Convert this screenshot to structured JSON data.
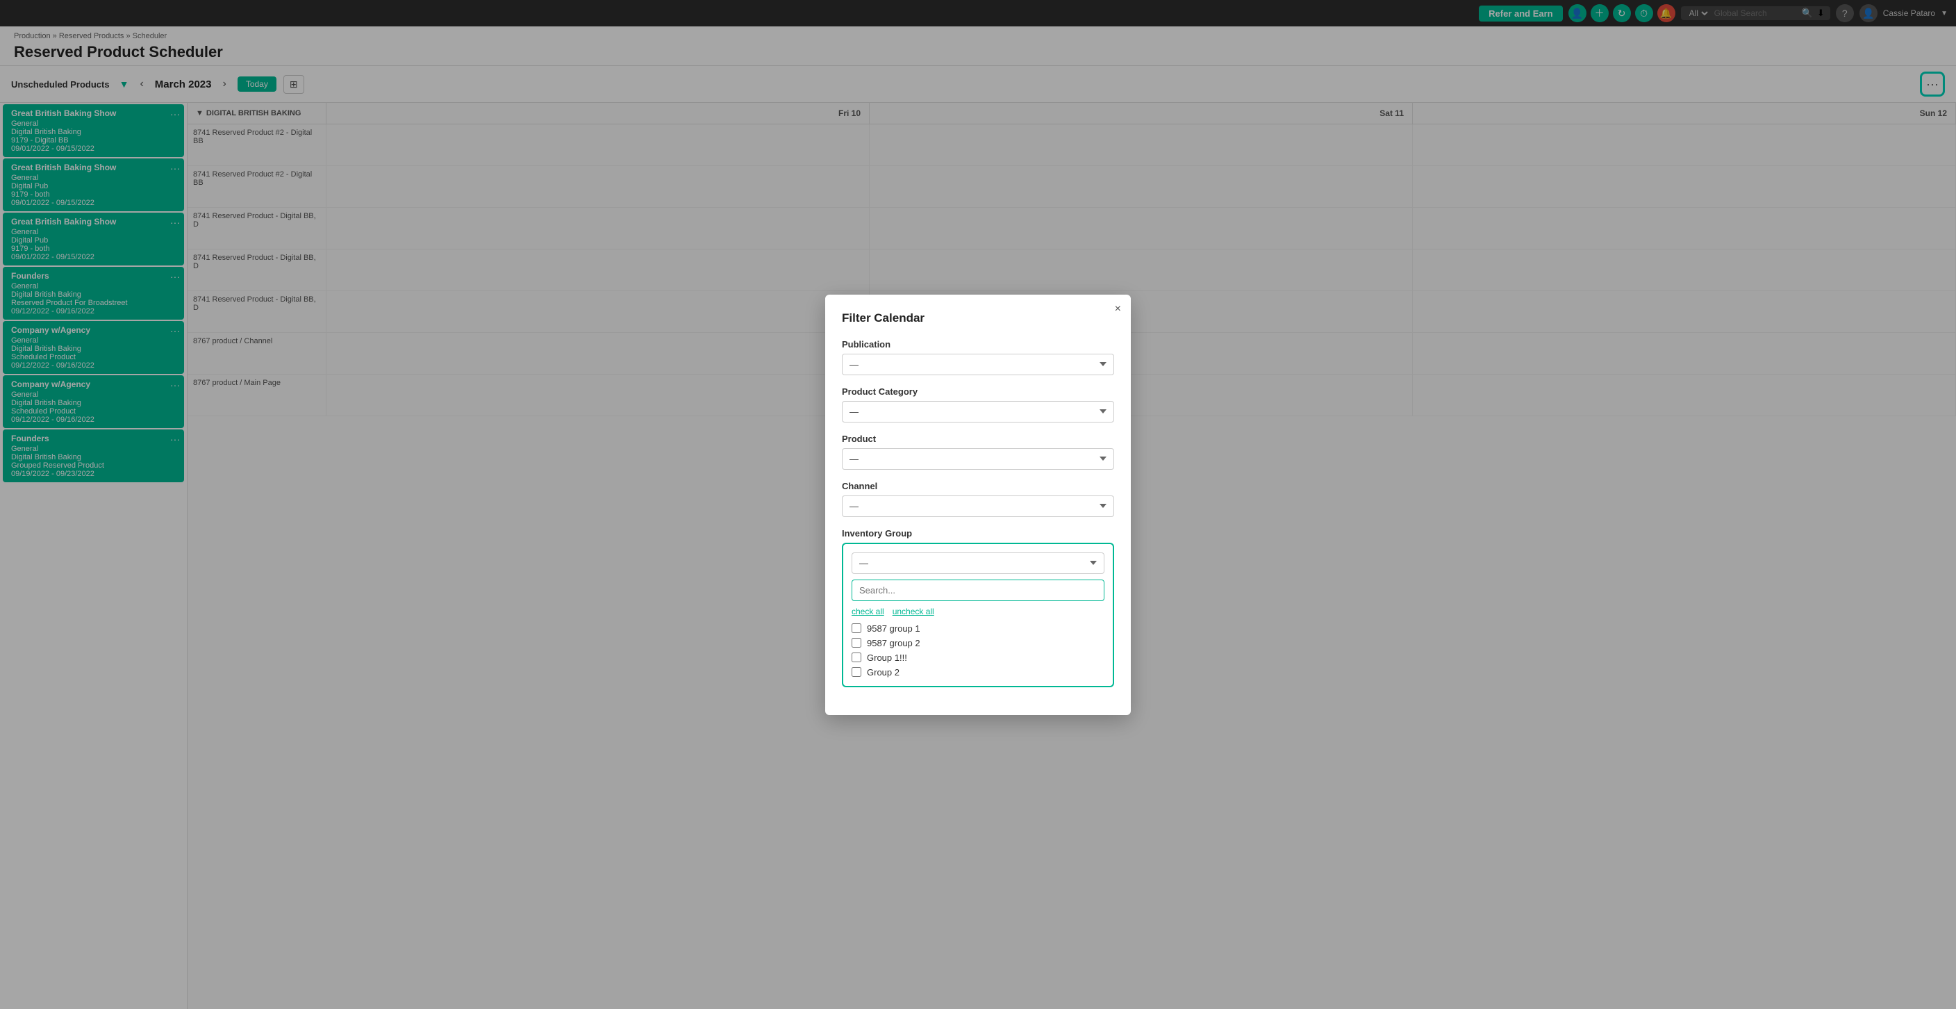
{
  "navbar": {
    "refer_label": "Refer and Earn",
    "search_placeholder": "Global Search",
    "search_scope": "All",
    "user": "Cassie Pataro"
  },
  "breadcrumb": {
    "parts": [
      "Production",
      "Reserved Products",
      "Scheduler"
    ]
  },
  "page": {
    "title": "Reserved Product Scheduler"
  },
  "toolbar": {
    "unscheduled_label": "Unscheduled Products",
    "prev_label": "‹",
    "next_label": "›",
    "month": "March 2023",
    "today_label": "Today",
    "more_label": "···"
  },
  "calendar": {
    "headers": [
      "",
      "Fri 10",
      "Sat 11",
      "Sun 12"
    ],
    "group_label": "DIGITAL BRITISH BAKING",
    "rows": [
      {
        "label": "8741 Reserved Product #2 - Digital BB",
        "fri": "",
        "sat": "",
        "sun": ""
      },
      {
        "label": "8741 Reserved Product #2 - Digital BB",
        "fri": "",
        "sat": "",
        "sun": ""
      },
      {
        "label": "8741 Reserved Product - Digital BB, D",
        "fri": "",
        "sat": "",
        "sun": ""
      },
      {
        "label": "8741 Reserved Product - Digital BB, D",
        "fri": "",
        "sat": "",
        "sun": ""
      },
      {
        "label": "8741 Reserved Product - Digital BB, D",
        "fri": "",
        "sat": "",
        "sun": ""
      },
      {
        "label": "8767 product / Channel",
        "fri": "",
        "sat": "",
        "sun": ""
      },
      {
        "label": "8767 product / Main Page",
        "fri": "",
        "sat": "",
        "sun": ""
      }
    ]
  },
  "left_panel": {
    "items": [
      {
        "title": "Great British Baking Show",
        "sub1": "General",
        "sub2": "Digital British Baking",
        "sub3": "9179 - Digital BB",
        "dates": "09/01/2022 - 09/15/2022"
      },
      {
        "title": "Great British Baking Show",
        "sub1": "General",
        "sub2": "Digital Pub",
        "sub3": "9179 - both",
        "dates": "09/01/2022 - 09/15/2022"
      },
      {
        "title": "Great British Baking Show",
        "sub1": "General",
        "sub2": "Digital Pub",
        "sub3": "9179 - both",
        "dates": "09/01/2022 - 09/15/2022"
      },
      {
        "title": "Founders",
        "sub1": "General",
        "sub2": "Digital British Baking",
        "sub3": "Reserved Product For Broadstreet",
        "dates": "09/12/2022 - 09/16/2022"
      },
      {
        "title": "Company w/Agency",
        "sub1": "General",
        "sub2": "Digital British Baking",
        "sub3": "Scheduled Product",
        "dates": "09/12/2022 - 09/16/2022"
      },
      {
        "title": "Company w/Agency",
        "sub1": "General",
        "sub2": "Digital British Baking",
        "sub3": "Scheduled Product",
        "dates": "09/12/2022 - 09/16/2022"
      },
      {
        "title": "Founders",
        "sub1": "General",
        "sub2": "Digital British Baking",
        "sub3": "Grouped Reserved Product",
        "dates": "09/19/2022 - 09/23/2022"
      }
    ]
  },
  "modal": {
    "title": "Filter Calendar",
    "close_label": "×",
    "filters": {
      "publication": {
        "label": "Publication",
        "value": "—",
        "options": [
          "—"
        ]
      },
      "product_category": {
        "label": "Product Category",
        "value": "—",
        "options": [
          "—"
        ]
      },
      "product": {
        "label": "Product",
        "value": "—",
        "options": [
          "—"
        ]
      },
      "channel": {
        "label": "Channel",
        "value": "—",
        "options": [
          "—"
        ]
      },
      "inventory_group": {
        "label": "Inventory Group",
        "value": "—",
        "search_placeholder": "Search...",
        "check_all_label": "check all",
        "uncheck_all_label": "uncheck all",
        "items": [
          {
            "id": "g1",
            "label": "9587 group 1",
            "checked": false
          },
          {
            "id": "g2",
            "label": "9587 group 2",
            "checked": false
          },
          {
            "id": "g3",
            "label": "Group 1!!!",
            "checked": false
          },
          {
            "id": "g4",
            "label": "Group 2",
            "checked": false
          }
        ]
      }
    }
  },
  "colors": {
    "brand": "#00b894",
    "brand_dark": "#00a381",
    "highlight_border": "#00d4bc"
  }
}
